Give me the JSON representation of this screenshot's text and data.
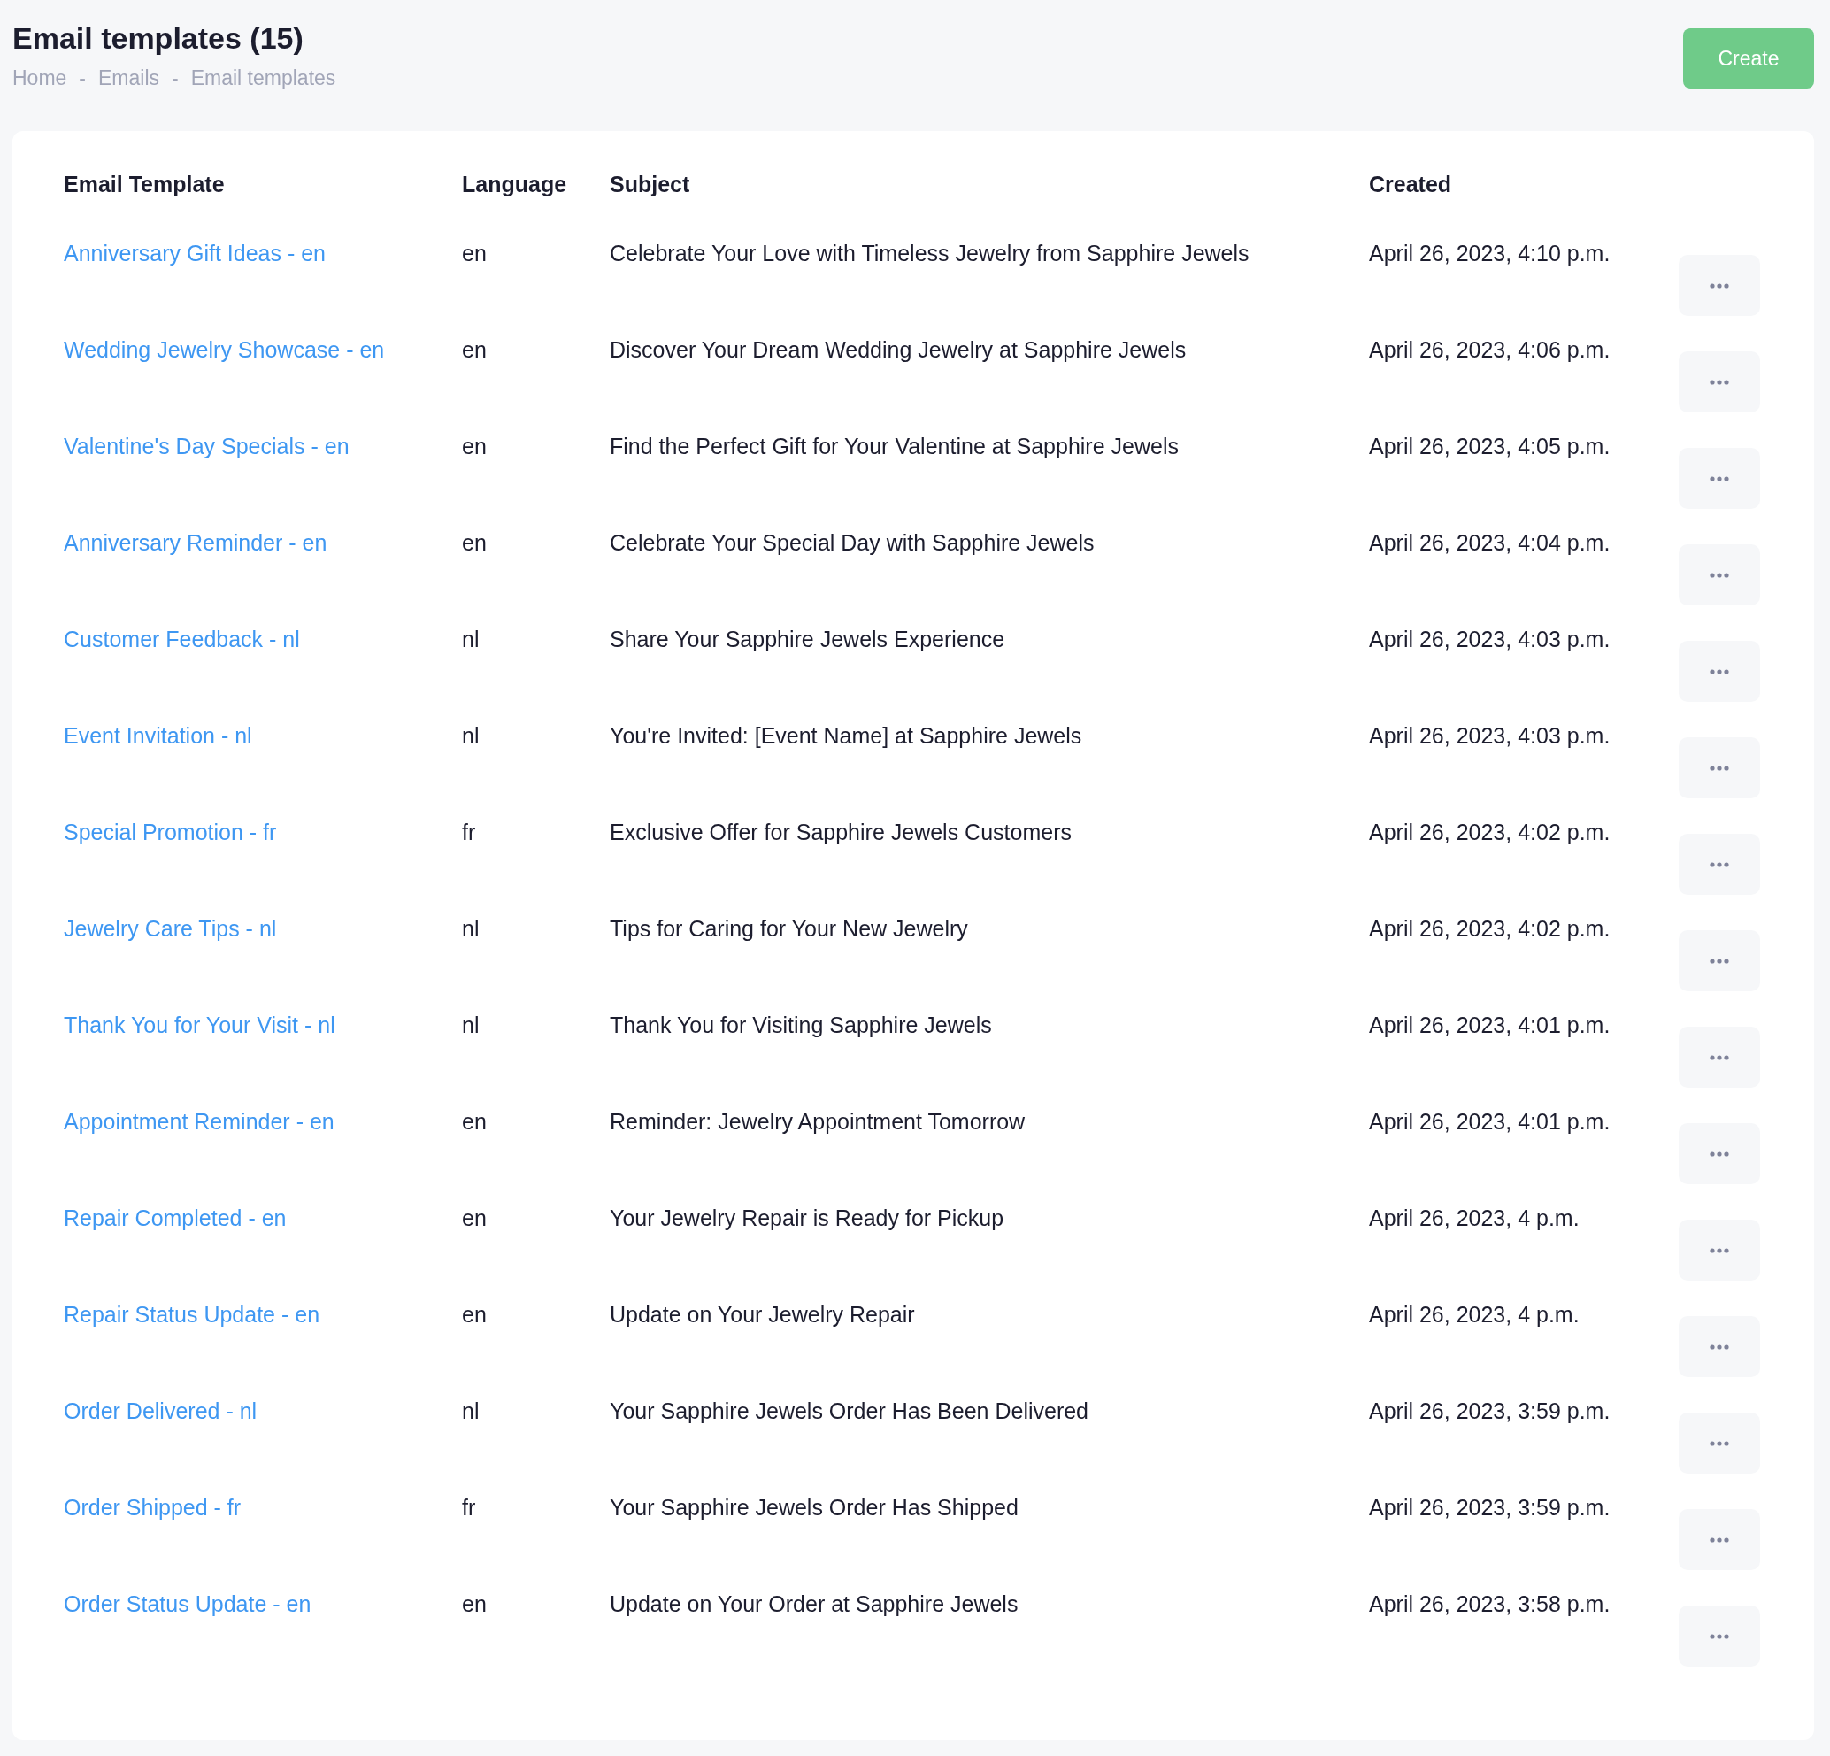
{
  "header": {
    "title": "Email templates (15)",
    "breadcrumb": [
      "Home",
      "Emails",
      "Email templates"
    ],
    "breadcrumb_separator": "-",
    "create_button": "Create"
  },
  "table": {
    "columns": [
      "Email Template",
      "Language",
      "Subject",
      "Created"
    ],
    "rows": [
      {
        "name": "Anniversary Gift Ideas - en",
        "language": "en",
        "subject": "Celebrate Your Love with Timeless Jewelry from Sapphire Jewels",
        "created": "April 26, 2023, 4:10 p.m."
      },
      {
        "name": "Wedding Jewelry Showcase - en",
        "language": "en",
        "subject": "Discover Your Dream Wedding Jewelry at Sapphire Jewels",
        "created": "April 26, 2023, 4:06 p.m."
      },
      {
        "name": "Valentine's Day Specials - en",
        "language": "en",
        "subject": "Find the Perfect Gift for Your Valentine at Sapphire Jewels",
        "created": "April 26, 2023, 4:05 p.m."
      },
      {
        "name": "Anniversary Reminder - en",
        "language": "en",
        "subject": "Celebrate Your Special Day with Sapphire Jewels",
        "created": "April 26, 2023, 4:04 p.m."
      },
      {
        "name": "Customer Feedback - nl",
        "language": "nl",
        "subject": "Share Your Sapphire Jewels Experience",
        "created": "April 26, 2023, 4:03 p.m."
      },
      {
        "name": "Event Invitation - nl",
        "language": "nl",
        "subject": "You're Invited: [Event Name] at Sapphire Jewels",
        "created": "April 26, 2023, 4:03 p.m."
      },
      {
        "name": "Special Promotion - fr",
        "language": "fr",
        "subject": "Exclusive Offer for Sapphire Jewels Customers",
        "created": "April 26, 2023, 4:02 p.m."
      },
      {
        "name": "Jewelry Care Tips - nl",
        "language": "nl",
        "subject": "Tips for Caring for Your New Jewelry",
        "created": "April 26, 2023, 4:02 p.m."
      },
      {
        "name": "Thank You for Your Visit - nl",
        "language": "nl",
        "subject": "Thank You for Visiting Sapphire Jewels",
        "created": "April 26, 2023, 4:01 p.m."
      },
      {
        "name": "Appointment Reminder - en",
        "language": "en",
        "subject": "Reminder: Jewelry Appointment Tomorrow",
        "created": "April 26, 2023, 4:01 p.m."
      },
      {
        "name": "Repair Completed - en",
        "language": "en",
        "subject": "Your Jewelry Repair is Ready for Pickup",
        "created": "April 26, 2023, 4 p.m."
      },
      {
        "name": "Repair Status Update - en",
        "language": "en",
        "subject": "Update on Your Jewelry Repair",
        "created": "April 26, 2023, 4 p.m."
      },
      {
        "name": "Order Delivered - nl",
        "language": "nl",
        "subject": "Your Sapphire Jewels Order Has Been Delivered",
        "created": "April 26, 2023, 3:59 p.m."
      },
      {
        "name": "Order Shipped - fr",
        "language": "fr",
        "subject": "Your Sapphire Jewels Order Has Shipped",
        "created": "April 26, 2023, 3:59 p.m."
      },
      {
        "name": "Order Status Update - en",
        "language": "en",
        "subject": "Update on Your Order at Sapphire Jewels",
        "created": "April 26, 2023, 3:58 p.m."
      }
    ]
  }
}
